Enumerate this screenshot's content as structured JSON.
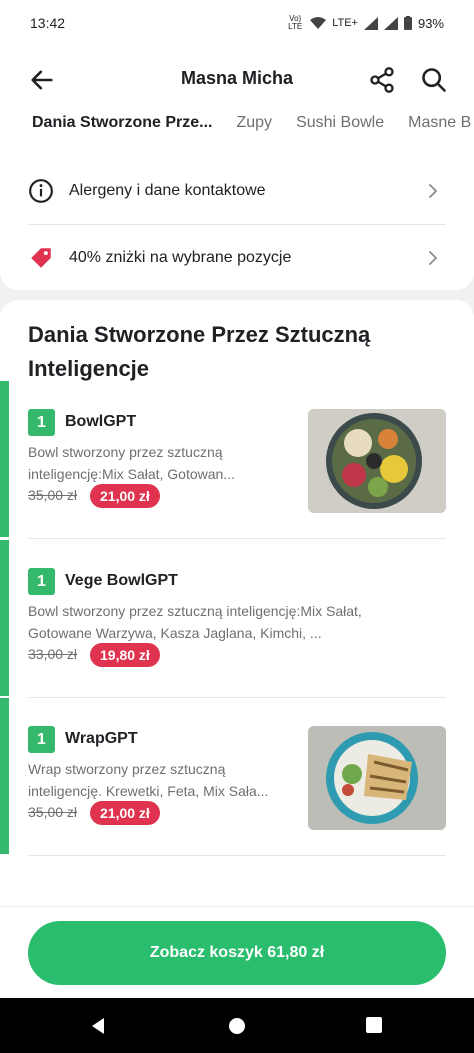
{
  "status": {
    "time": "13:42",
    "network_top": "Vo) LTE",
    "lte": "LTE+",
    "battery": "93%"
  },
  "header": {
    "title": "Masna Micha"
  },
  "tabs": [
    {
      "label": "Dania Stworzone Prze..."
    },
    {
      "label": "Zupy"
    },
    {
      "label": "Sushi Bowle"
    },
    {
      "label": "Masne B"
    }
  ],
  "info": {
    "allergens_label": "Alergeny i dane kontaktowe",
    "discount_label": "40% zniżki na wybrane pozycje"
  },
  "section": {
    "title": "Dania Stworzone Przez Sztuczną Inteligencje"
  },
  "items": [
    {
      "qty": "1",
      "name": "BowlGPT",
      "description": "Bowl stworzony przez sztuczną inteligencję:Mix Sałat,  Gotowan...",
      "old_price": "35,00 zł",
      "new_price": "21,00 zł"
    },
    {
      "qty": "1",
      "name": "Vege BowlGPT",
      "description": "Bowl stworzony przez sztuczną inteligencję:Mix Sałat,  Gotowane Warzywa, Kasza Jaglana, Kimchi, ...",
      "old_price": "33,00 zł",
      "new_price": "19,80 zł"
    },
    {
      "qty": "1",
      "name": "WrapGPT",
      "description": "Wrap stworzony przez sztuczną inteligencję. Krewetki, Feta, Mix Sała...",
      "old_price": "35,00 zł",
      "new_price": "21,00 zł"
    }
  ],
  "cart": {
    "label": "Zobacz koszyk 61,80 zł"
  },
  "colors": {
    "brand_green": "#2bbd6e",
    "discount_red": "#e0334f"
  }
}
